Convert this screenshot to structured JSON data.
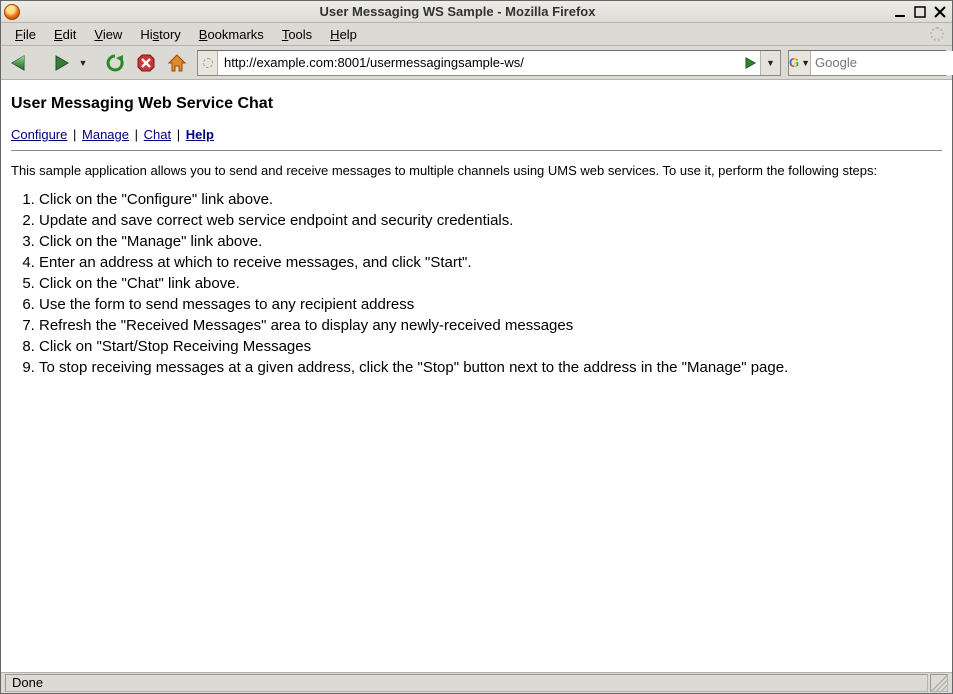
{
  "window": {
    "title": "User Messaging WS Sample - Mozilla Firefox"
  },
  "menu": {
    "file": "File",
    "edit": "Edit",
    "view": "View",
    "history": "History",
    "bookmarks": "Bookmarks",
    "tools": "Tools",
    "help": "Help"
  },
  "toolbar": {
    "url": "http://example.com:8001/usermessagingsample-ws/",
    "search_placeholder": "Google"
  },
  "page": {
    "heading": "User Messaging Web Service Chat",
    "nav": {
      "configure": "Configure",
      "manage": "Manage",
      "chat": "Chat",
      "help": "Help"
    },
    "intro": "This sample application allows you to send and receive messages to multiple channels using UMS web services. To use it, perform the following steps:",
    "steps": [
      "Click on the \"Configure\" link above.",
      "Update and save correct web service endpoint and security credentials.",
      "Click on the \"Manage\" link above.",
      "Enter an address at which to receive messages, and click \"Start\".",
      "Click on the \"Chat\" link above.",
      "Use the form to send messages to any recipient address",
      "Refresh the \"Received Messages\" area to display any newly-received messages",
      "Click on \"Start/Stop Receiving Messages",
      "To stop receiving messages at a given address, click the \"Stop\" button next to the address in the \"Manage\" page."
    ]
  },
  "status": {
    "text": "Done"
  }
}
